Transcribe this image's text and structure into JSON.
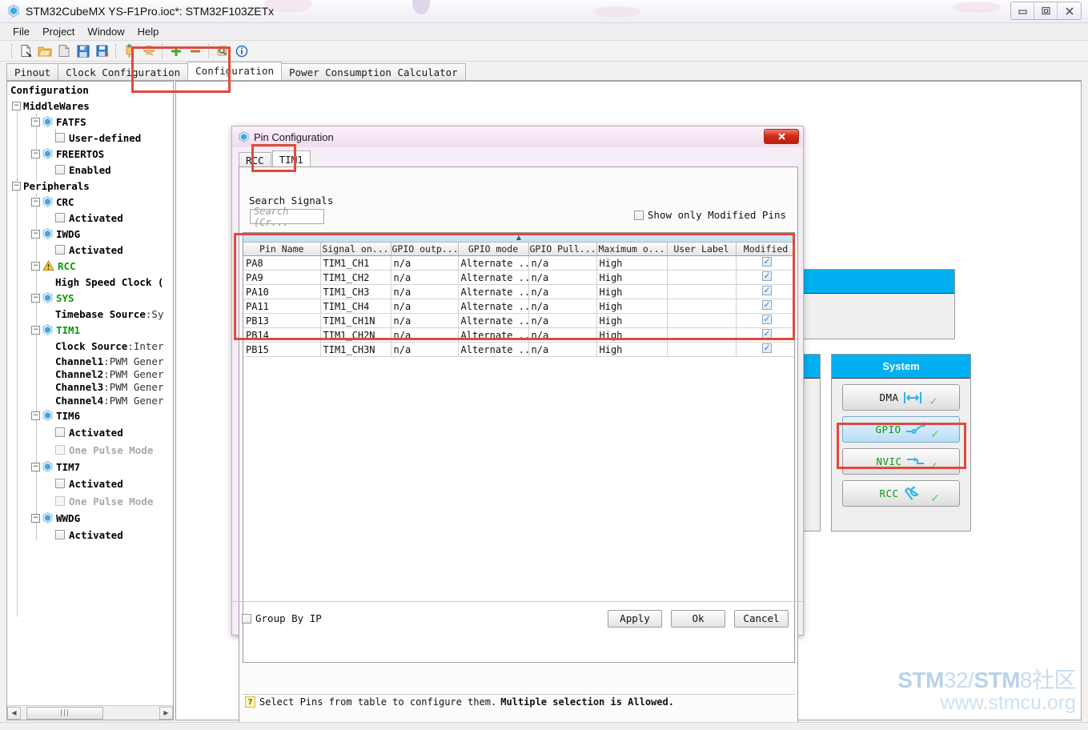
{
  "window": {
    "title": "STM32CubeMX YS-F1Pro.ioc*: STM32F103ZETx",
    "app_icon": "cube-icon",
    "controls": {
      "minimize": "–",
      "maximize": "□",
      "close": "✕"
    }
  },
  "menu": {
    "items": [
      "File",
      "Project",
      "Window",
      "Help"
    ]
  },
  "toolbar": {
    "buttons": [
      "new-project-icon",
      "open-project-icon",
      "save-project-icon",
      "save-icon",
      "save-as-icon",
      "generate-report-icon",
      "generate-code-icon",
      "zoom-in-icon",
      "zoom-out-icon",
      "find-icon",
      "about-icon"
    ]
  },
  "main_tabs": {
    "items": [
      "Pinout",
      "Clock Configuration",
      "Configuration",
      "Power Consumption Calculator"
    ],
    "active": "Configuration"
  },
  "sidebar": {
    "header": "Configuration",
    "nodes": [
      {
        "label": "MiddleWares",
        "kind": "group",
        "indent": 0,
        "expander": "-"
      },
      {
        "label": "FATFS",
        "kind": "peripheral",
        "indent": 1,
        "expander": "-",
        "icon": "hex-icon"
      },
      {
        "label": "User-defined",
        "kind": "checkbox",
        "indent": 2,
        "checked": false
      },
      {
        "label": "FREERTOS",
        "kind": "peripheral",
        "indent": 1,
        "expander": "-",
        "icon": "hex-icon"
      },
      {
        "label": "Enabled",
        "kind": "checkbox",
        "indent": 2,
        "checked": false
      },
      {
        "label": "Peripherals",
        "kind": "group",
        "indent": 0,
        "expander": "-"
      },
      {
        "label": "CRC",
        "kind": "peripheral",
        "indent": 1,
        "expander": "-",
        "icon": "hex-icon"
      },
      {
        "label": "Activated",
        "kind": "checkbox",
        "indent": 2,
        "checked": false
      },
      {
        "label": "IWDG",
        "kind": "peripheral",
        "indent": 1,
        "expander": "-",
        "icon": "hex-icon"
      },
      {
        "label": "Activated",
        "kind": "checkbox",
        "indent": 2,
        "checked": false
      },
      {
        "label": "RCC",
        "kind": "peripheral-green",
        "indent": 1,
        "expander": "-",
        "icon": "warning-icon"
      },
      {
        "label": "High Speed Clock (HS",
        "kind": "value",
        "indent": 2
      },
      {
        "label": "SYS",
        "kind": "peripheral-green",
        "indent": 1,
        "expander": "-",
        "icon": "hex-icon"
      },
      {
        "label": "Timebase Source",
        "value": ":SysTi",
        "kind": "value-pair",
        "indent": 2
      },
      {
        "label": "TIM1",
        "kind": "peripheral-green",
        "indent": 1,
        "expander": "-",
        "icon": "hex-icon"
      },
      {
        "label": "Clock Source ",
        "value": ":Interna",
        "kind": "value-pair",
        "indent": 2
      },
      {
        "label": "Channel1",
        "value": ":PWM Generatio",
        "kind": "value-pair",
        "indent": 2
      },
      {
        "label": "Channel2",
        "value": ":PWM Generatio",
        "kind": "value-pair",
        "indent": 2
      },
      {
        "label": "Channel3",
        "value": ":PWM Generatio",
        "kind": "value-pair",
        "indent": 2
      },
      {
        "label": "Channel4",
        "value": ":PWM Generatio",
        "kind": "value-pair",
        "indent": 2
      },
      {
        "label": "TIM6",
        "kind": "peripheral",
        "indent": 1,
        "expander": "-",
        "icon": "hex-icon"
      },
      {
        "label": "Activated",
        "kind": "checkbox",
        "indent": 2,
        "checked": false
      },
      {
        "label": "One Pulse Mode",
        "kind": "checkbox-disabled",
        "indent": 2,
        "checked": false
      },
      {
        "label": "TIM7",
        "kind": "peripheral",
        "indent": 1,
        "expander": "-",
        "icon": "hex-icon"
      },
      {
        "label": "Activated",
        "kind": "checkbox",
        "indent": 2,
        "checked": false
      },
      {
        "label": "One Pulse Mode",
        "kind": "checkbox-disabled",
        "indent": 2,
        "checked": false
      },
      {
        "label": "WWDG",
        "kind": "peripheral",
        "indent": 1,
        "expander": "-",
        "icon": "hex-icon"
      },
      {
        "label": "Activated",
        "kind": "checkbox",
        "indent": 2,
        "checked": false
      }
    ],
    "scrollbar": {
      "left_arrow": "◀",
      "right_arrow": "▶",
      "grip": "|||"
    }
  },
  "system_panel": {
    "title": "System",
    "buttons": [
      {
        "label": "DMA",
        "icon": "dma-icon",
        "selected": false,
        "label_color": "dark"
      },
      {
        "label": "GPIO",
        "icon": "gpio-icon",
        "selected": true,
        "label_color": "green"
      },
      {
        "label": "NVIC",
        "icon": "nvic-icon",
        "selected": false,
        "label_color": "green"
      },
      {
        "label": "RCC",
        "icon": "rcc-wrench-icon",
        "selected": false,
        "label_color": "green"
      }
    ]
  },
  "dialog": {
    "title": "Pin Configuration",
    "icon": "cube-icon",
    "close_label": "✕",
    "tabs": [
      "RCC",
      "TIM1"
    ],
    "active_tab": "TIM1",
    "search_label": "Search Signals",
    "search_placeholder": "Search (Cr...",
    "show_modified_label": "Show only Modified Pins",
    "show_modified_checked": false,
    "table": {
      "headers": [
        "Pin Name",
        "Signal on...",
        "GPIO outp...",
        "GPIO mode",
        "GPIO Pull...",
        "Maximum o...",
        "User Label",
        "Modified"
      ],
      "rows": [
        {
          "pin": "PA8",
          "signal": "TIM1_CH1",
          "output": "n/a",
          "mode": "Alternate ...",
          "pull": "n/a",
          "speed": "High",
          "user_label": "",
          "modified": true
        },
        {
          "pin": "PA9",
          "signal": "TIM1_CH2",
          "output": "n/a",
          "mode": "Alternate ...",
          "pull": "n/a",
          "speed": "High",
          "user_label": "",
          "modified": true
        },
        {
          "pin": "PA10",
          "signal": "TIM1_CH3",
          "output": "n/a",
          "mode": "Alternate ...",
          "pull": "n/a",
          "speed": "High",
          "user_label": "",
          "modified": true
        },
        {
          "pin": "PA11",
          "signal": "TIM1_CH4",
          "output": "n/a",
          "mode": "Alternate ...",
          "pull": "n/a",
          "speed": "High",
          "user_label": "",
          "modified": true
        },
        {
          "pin": "PB13",
          "signal": "TIM1_CH1N",
          "output": "n/a",
          "mode": "Alternate ...",
          "pull": "n/a",
          "speed": "High",
          "user_label": "",
          "modified": true
        },
        {
          "pin": "PB14",
          "signal": "TIM1_CH2N",
          "output": "n/a",
          "mode": "Alternate ...",
          "pull": "n/a",
          "speed": "High",
          "user_label": "",
          "modified": true
        },
        {
          "pin": "PB15",
          "signal": "TIM1_CH3N",
          "output": "n/a",
          "mode": "Alternate ...",
          "pull": "n/a",
          "speed": "High",
          "user_label": "",
          "modified": true
        }
      ]
    },
    "hint": {
      "icon": "question-icon",
      "text": "Select Pins from table to configure them.",
      "bold_text": "Multiple selection is Allowed."
    },
    "footer": {
      "group_by_ip_label": "Group By IP",
      "group_by_ip_checked": false,
      "apply_label": "Apply",
      "ok_label": "Ok",
      "cancel_label": "Cancel"
    }
  },
  "watermark": {
    "line1_a": "STM",
    "line1_b": "32/",
    "line1_c": "STM",
    "line1_d": "8社区",
    "line2": "www.stmcu.org"
  },
  "annotations": {
    "color": "#e04a3c"
  }
}
